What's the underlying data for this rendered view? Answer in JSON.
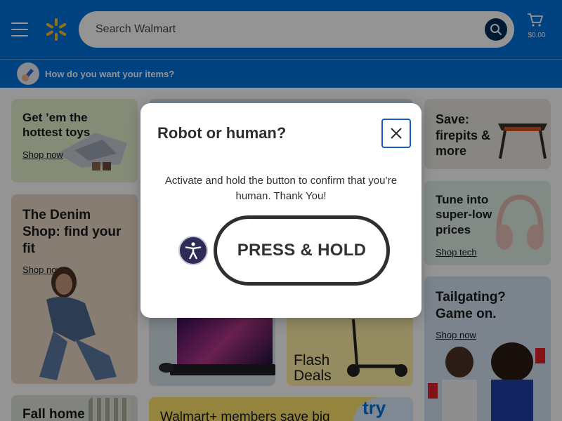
{
  "header": {
    "search_placeholder": "Search Walmart",
    "cart_amount": "$0.00"
  },
  "subheader": {
    "text": "How do you want your items?"
  },
  "tiles": {
    "toys": {
      "title_line1": "Get ’em the",
      "title_line2": "hottest toys",
      "link": "Shop now"
    },
    "denim": {
      "title_line1": "The Denim",
      "title_line2": "Shop: find your",
      "title_line3": "fit",
      "link": "Shop now"
    },
    "fall": {
      "title": "Fall home"
    },
    "firepits": {
      "title_line1": "Save:",
      "title_line2": "firepits &",
      "title_line3": "more"
    },
    "tech": {
      "title_line1": "Tune into",
      "title_line2": "super-low",
      "title_line3": "prices",
      "link": "Shop tech"
    },
    "tailgating": {
      "title_line1": "Tailgating?",
      "title_line2": "Game on.",
      "link": "Shop now"
    },
    "flash": {
      "line1": "Flash",
      "line2": "Deals"
    },
    "walmart_plus": {
      "text": "Walmart+ members save big",
      "try_text": "try"
    }
  },
  "modal": {
    "title": "Robot or human?",
    "message": "Activate and hold the button to confirm that you’re human. Thank You!",
    "hold_button": "PRESS & HOLD"
  },
  "colors": {
    "brand_blue": "#0071dc",
    "brand_yellow": "#ffc220",
    "dark_navy": "#002d58"
  }
}
